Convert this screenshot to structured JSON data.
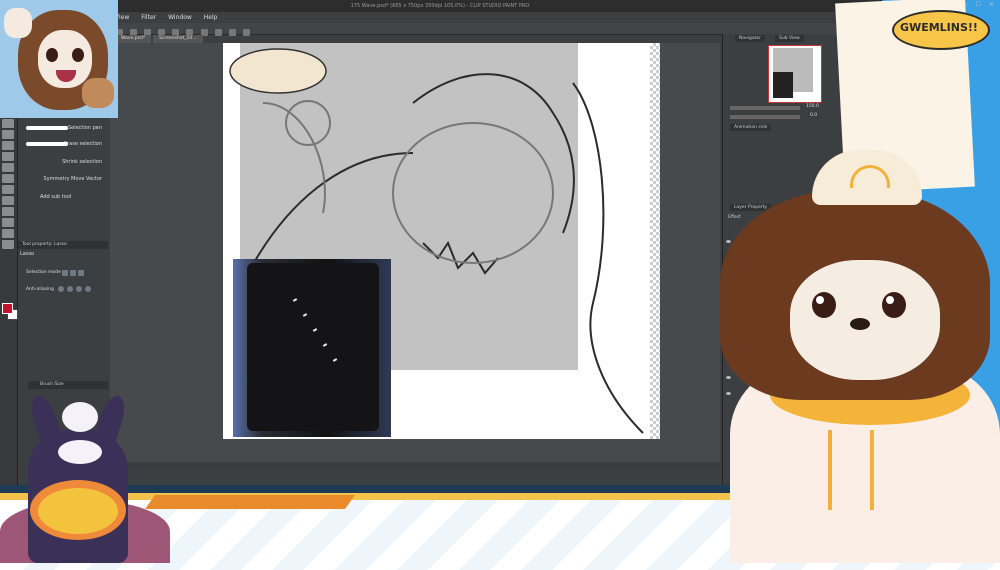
{
  "window": {
    "title": "175 Wave.psd* (665 x 750px 350dpi 105.0%) - CLIP STUDIO PAINT PRO",
    "controls": [
      "—",
      "☐",
      "✕"
    ]
  },
  "menu": {
    "items": [
      "View",
      "Filter",
      "Window",
      "Help"
    ]
  },
  "tabs": {
    "items": [
      "Wave.psd*",
      "Screenshot_20..."
    ]
  },
  "subtool": {
    "items": [
      {
        "label": "Selection pen",
        "active": false
      },
      {
        "label": "Erase selection",
        "active": false
      },
      {
        "label": "Shrink selection",
        "active": false
      },
      {
        "label": "Symmetry Move Vector",
        "active": false
      }
    ],
    "add_label": "Add sub tool"
  },
  "tool_property": {
    "header": "Tool property: Lasso",
    "title": "Lasso",
    "selection_mode_label": "Selection mode",
    "anti_aliasing_label": "Anti-aliasing"
  },
  "brush_size": {
    "header": "Brush Size"
  },
  "canvas": {
    "zoom": "150.0"
  },
  "panels": {
    "navigator": "Navigator",
    "subview": "Sub View",
    "animation": "Animation cels",
    "layer_property": "Layer Property",
    "effect": "Effect",
    "nav_zoom": "150.0",
    "nav_angle": "0.0"
  },
  "layers": {
    "items": [
      "Shape 2",
      "100 % Normal",
      "100 % Normal",
      "100 % Normal"
    ]
  },
  "overlay": {
    "sign_text": "GWEMLINS!!"
  },
  "colors": {
    "accent": "#f7c548",
    "fg_color": "#c8102e",
    "stream_blue": "#3aa0e6"
  }
}
